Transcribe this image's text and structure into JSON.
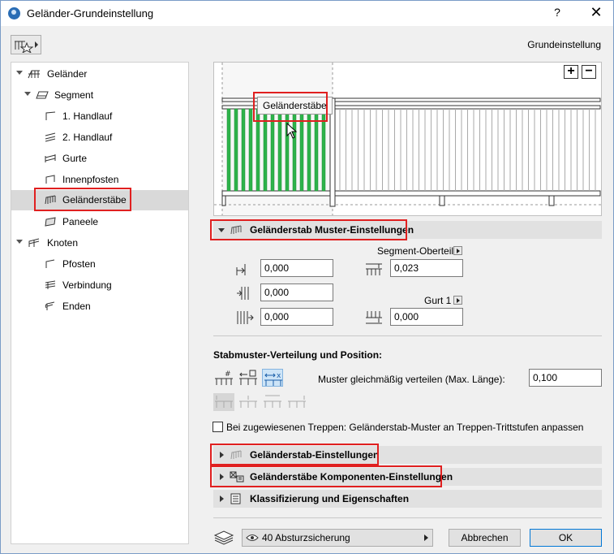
{
  "window": {
    "title": "Geländer-Grundeinstellung",
    "help_label": "?",
    "close_label": "✕"
  },
  "header": {
    "right_label": "Grundeinstellung"
  },
  "tree": {
    "items": [
      {
        "label": "Geländer",
        "icon": "railing-icon"
      },
      {
        "label": "Segment",
        "icon": "segment-icon"
      },
      {
        "label": "1. Handlauf",
        "icon": "handrail-icon"
      },
      {
        "label": "2. Handlauf",
        "icon": "handrail2-icon"
      },
      {
        "label": "Gurte",
        "icon": "rails-icon"
      },
      {
        "label": "Innenpfosten",
        "icon": "inner-post-icon"
      },
      {
        "label": "Geländerstäbe",
        "icon": "balusters-icon",
        "selected": true
      },
      {
        "label": "Paneele",
        "icon": "panel-icon"
      },
      {
        "label": "Knoten",
        "icon": "node-icon"
      },
      {
        "label": "Pfosten",
        "icon": "post-icon"
      },
      {
        "label": "Verbindung",
        "icon": "connection-icon"
      },
      {
        "label": "Enden",
        "icon": "ends-icon"
      }
    ]
  },
  "preview": {
    "tooltip": "Geländerstäbe",
    "zoom_in": "+",
    "zoom_out": "−"
  },
  "pattern_section": {
    "title": "Geländerstab Muster-Einstellungen",
    "left_fields": [
      "0,000",
      "0,000",
      "0,000"
    ],
    "segment_top_label": "Segment-Oberteil",
    "segment_top_value": "0,023",
    "rail_label": "Gurt 1",
    "rail_value": "0,000"
  },
  "distribution": {
    "title": "Stabmuster-Verteilung und Position:",
    "spread_label": "Muster gleichmäßig verteilen (Max. Länge):",
    "spread_value": "0,100",
    "stairs_checkbox_label": "Bei zugewiesenen Treppen: Geländerstab-Muster an Treppen-Trittstufen anpassen",
    "stairs_checked": false
  },
  "sections": {
    "baluster_settings": "Geländerstab-Einstellungen",
    "components": "Geländerstäbe Komponenten-Einstellungen",
    "classification": "Klassifizierung und Eigenschaften"
  },
  "footer": {
    "layer_value": "40 Absturzsicherung",
    "cancel_label": "Abbrechen",
    "ok_label": "OK"
  },
  "colors": {
    "highlight_red": "#e02020",
    "baluster_green": "#2db34a",
    "selection_bg": "#d9d9d9"
  }
}
